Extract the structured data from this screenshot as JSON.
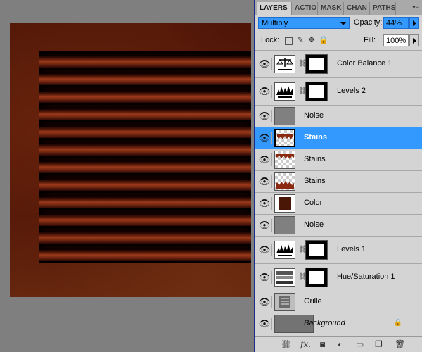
{
  "tabs": [
    {
      "label": "LAYERS",
      "active": true
    },
    {
      "label": "ACTIO",
      "active": false
    },
    {
      "label": "MASK",
      "active": false
    },
    {
      "label": "CHAN",
      "active": false
    },
    {
      "label": "PATHS",
      "active": false
    }
  ],
  "blend": {
    "mode": "Multiply"
  },
  "opacity": {
    "label": "Opacity:",
    "value": "44%"
  },
  "lock": {
    "label": "Lock:"
  },
  "fill": {
    "label": "Fill:",
    "value": "100%"
  },
  "layers": [
    {
      "name": "Color Balance 1",
      "type": "adjustment",
      "icon": "balance-icon",
      "mask": true
    },
    {
      "name": "Levels 2",
      "type": "adjustment",
      "icon": "levels-icon",
      "mask": true
    },
    {
      "name": "Noise",
      "type": "pixel",
      "icon": "noise-thumb"
    },
    {
      "name": "Stains",
      "type": "pixel",
      "icon": "stains-thumb",
      "selected": true
    },
    {
      "name": "Stains",
      "type": "pixel",
      "icon": "stains-thumb"
    },
    {
      "name": "Stains",
      "type": "pixel",
      "icon": "stains-thumb"
    },
    {
      "name": "Color",
      "type": "pixel",
      "icon": "color-thumb"
    },
    {
      "name": "Noise",
      "type": "pixel",
      "icon": "noise-thumb"
    },
    {
      "name": "Levels 1",
      "type": "adjustment",
      "icon": "levels-icon",
      "mask": true
    },
    {
      "name": "Hue/Saturation 1",
      "type": "adjustment",
      "icon": "hue-saturation-icon",
      "mask": true
    },
    {
      "name": "Grille",
      "type": "pixel",
      "icon": "grille-thumb"
    },
    {
      "name": "Background",
      "type": "background",
      "icon": "background-thumb",
      "locked": true
    }
  ],
  "colors": {
    "selection": "#3399ff",
    "panel": "#d4d4d4",
    "canvas_bg": "#7f7f7f",
    "rust": "#7a2710"
  }
}
